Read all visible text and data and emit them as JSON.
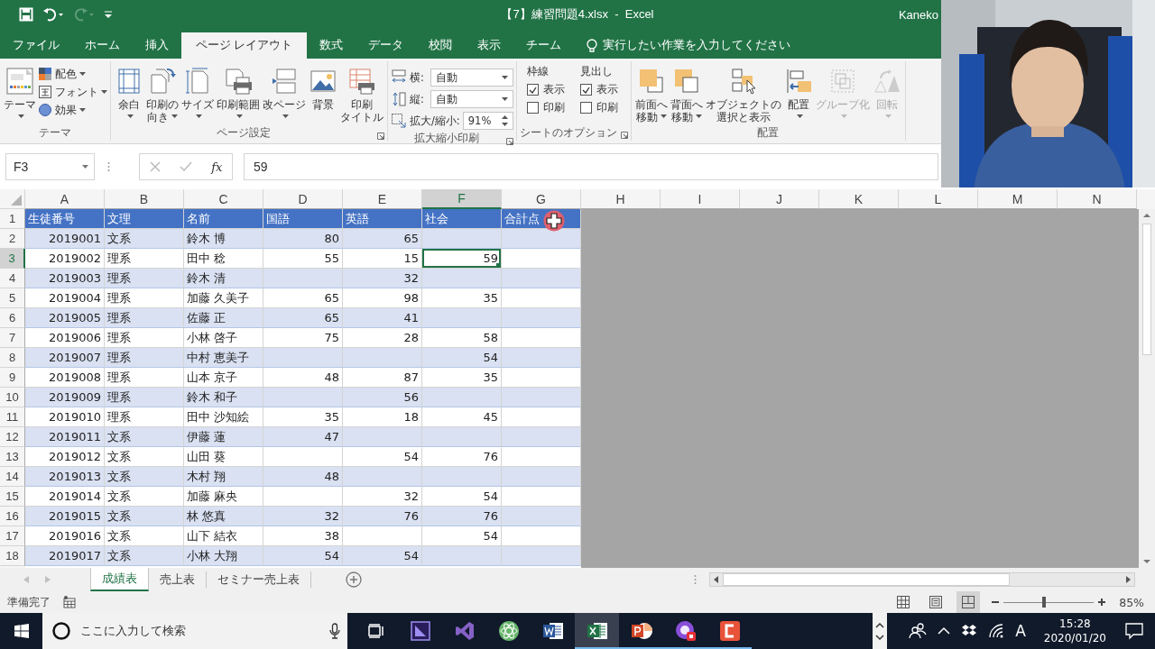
{
  "window": {
    "title": "【7】練習問題4.xlsx  -  Excel",
    "user": "Kaneko"
  },
  "ribbon_tabs": [
    {
      "label": "ファイル",
      "selected": false
    },
    {
      "label": "ホーム",
      "selected": false
    },
    {
      "label": "挿入",
      "selected": false
    },
    {
      "label": "ページ レイアウト",
      "selected": true
    },
    {
      "label": "数式",
      "selected": false
    },
    {
      "label": "データ",
      "selected": false
    },
    {
      "label": "校閲",
      "selected": false
    },
    {
      "label": "表示",
      "selected": false
    },
    {
      "label": "チーム",
      "selected": false
    }
  ],
  "tell_me": {
    "placeholder": "実行したい作業を入力してください"
  },
  "ribbon": {
    "groups": [
      {
        "kind": "theme",
        "label": "テーマ",
        "launcher": false,
        "large": [
          {
            "lines": [
              "テーマ"
            ],
            "dropdown": true,
            "disabled": false
          }
        ],
        "small": [
          {
            "label": "配色",
            "dropdown": true
          },
          {
            "label": "フォント",
            "dropdown": true
          },
          {
            "label": "効果",
            "dropdown": true
          }
        ]
      },
      {
        "kind": "buttons",
        "label": "ページ設定",
        "launcher": true,
        "large": [
          {
            "lines": [
              "余白"
            ],
            "dropdown": true,
            "disabled": false
          },
          {
            "lines": [
              "印刷の",
              "向き"
            ],
            "dropdown": true,
            "disabled": false
          },
          {
            "lines": [
              "サイズ"
            ],
            "dropdown": true,
            "disabled": false
          },
          {
            "lines": [
              "印刷範囲"
            ],
            "dropdown": true,
            "disabled": false
          },
          {
            "lines": [
              "改ページ"
            ],
            "dropdown": true,
            "disabled": false
          },
          {
            "lines": [
              "背景"
            ],
            "dropdown": false,
            "disabled": false
          },
          {
            "lines": [
              "印刷",
              "タイトル"
            ],
            "dropdown": false,
            "disabled": false
          }
        ]
      },
      {
        "kind": "scale",
        "label": "拡大縮小印刷",
        "launcher": true,
        "fields": [
          {
            "label": "横:",
            "value": "自動",
            "kind": "dropdown"
          },
          {
            "label": "縦:",
            "value": "自動",
            "kind": "dropdown"
          },
          {
            "label": "拡大/縮小:",
            "value": "91%",
            "kind": "spinner"
          }
        ]
      },
      {
        "kind": "options",
        "label": "シートのオプション",
        "launcher": true,
        "columns": [
          {
            "heading": "枠線",
            "checks": [
              {
                "label": "表示",
                "checked": true
              },
              {
                "label": "印刷",
                "checked": false
              }
            ]
          },
          {
            "heading": "見出し",
            "checks": [
              {
                "label": "表示",
                "checked": true
              },
              {
                "label": "印刷",
                "checked": false
              }
            ]
          }
        ]
      },
      {
        "kind": "buttons",
        "label": "配置",
        "launcher": false,
        "large": [
          {
            "lines": [
              "前面へ",
              "移動"
            ],
            "dropdown": true,
            "disabled": false
          },
          {
            "lines": [
              "背面へ",
              "移動"
            ],
            "dropdown": true,
            "disabled": false
          },
          {
            "lines": [
              "オブジェクトの",
              "選択と表示"
            ],
            "dropdown": false,
            "disabled": false
          },
          {
            "lines": [
              "配置"
            ],
            "dropdown": true,
            "disabled": false
          },
          {
            "lines": [
              "グループ化"
            ],
            "dropdown": true,
            "disabled": true
          },
          {
            "lines": [
              "回転"
            ],
            "dropdown": true,
            "disabled": true
          }
        ]
      }
    ]
  },
  "formula_bar": {
    "name_box": "F3",
    "insert_function": "fx",
    "value": "59"
  },
  "sheet": {
    "columns": [
      {
        "letter": "A",
        "kind": "number",
        "selected": false
      },
      {
        "letter": "B",
        "kind": "text",
        "selected": false
      },
      {
        "letter": "C",
        "kind": "text",
        "selected": false
      },
      {
        "letter": "D",
        "kind": "number",
        "selected": false
      },
      {
        "letter": "E",
        "kind": "number",
        "selected": false
      },
      {
        "letter": "F",
        "kind": "number",
        "selected": true
      },
      {
        "letter": "G",
        "kind": "number",
        "selected": false
      },
      {
        "letter": "H",
        "selected": false
      },
      {
        "letter": "I",
        "selected": false
      },
      {
        "letter": "J",
        "selected": false
      },
      {
        "letter": "K",
        "selected": false
      },
      {
        "letter": "L",
        "selected": false
      },
      {
        "letter": "M",
        "selected": false
      },
      {
        "letter": "N",
        "selected": false
      }
    ],
    "rows": [
      {
        "number": "1",
        "kind": "header",
        "selected": false,
        "cells": [
          "生徒番号",
          "文理",
          "名前",
          "国語",
          "英語",
          "社会",
          "合計点"
        ]
      },
      {
        "number": "2",
        "kind": "data",
        "selected": false,
        "cells": [
          "2019001",
          "文系",
          "鈴木 博",
          "80",
          "65",
          null,
          null
        ]
      },
      {
        "number": "3",
        "kind": "data",
        "selected": true,
        "cells": [
          "2019002",
          "理系",
          "田中 稔",
          "55",
          "15",
          "59",
          null
        ]
      },
      {
        "number": "4",
        "kind": "data",
        "selected": false,
        "cells": [
          "2019003",
          "理系",
          "鈴木 清",
          null,
          "32",
          null,
          null
        ]
      },
      {
        "number": "5",
        "kind": "data",
        "selected": false,
        "cells": [
          "2019004",
          "理系",
          "加藤 久美子",
          "65",
          "98",
          "35",
          null
        ]
      },
      {
        "number": "6",
        "kind": "data",
        "selected": false,
        "cells": [
          "2019005",
          "理系",
          "佐藤 正",
          "65",
          "41",
          null,
          null
        ]
      },
      {
        "number": "7",
        "kind": "data",
        "selected": false,
        "cells": [
          "2019006",
          "理系",
          "小林 啓子",
          "75",
          "28",
          "58",
          null
        ]
      },
      {
        "number": "8",
        "kind": "data",
        "selected": false,
        "cells": [
          "2019007",
          "理系",
          "中村 恵美子",
          null,
          null,
          "54",
          null
        ]
      },
      {
        "number": "9",
        "kind": "data",
        "selected": false,
        "cells": [
          "2019008",
          "理系",
          "山本 京子",
          "48",
          "87",
          "35",
          null
        ]
      },
      {
        "number": "10",
        "kind": "data",
        "selected": false,
        "cells": [
          "2019009",
          "理系",
          "鈴木 和子",
          null,
          "56",
          null,
          null
        ]
      },
      {
        "number": "11",
        "kind": "data",
        "selected": false,
        "cells": [
          "2019010",
          "理系",
          "田中 沙知絵",
          "35",
          "18",
          "45",
          null
        ]
      },
      {
        "number": "12",
        "kind": "data",
        "selected": false,
        "cells": [
          "2019011",
          "文系",
          "伊藤 蓮",
          "47",
          null,
          null,
          null
        ]
      },
      {
        "number": "13",
        "kind": "data",
        "selected": false,
        "cells": [
          "2019012",
          "文系",
          "山田 葵",
          null,
          "54",
          "76",
          null
        ]
      },
      {
        "number": "14",
        "kind": "data",
        "selected": false,
        "cells": [
          "2019013",
          "文系",
          "木村 翔",
          "48",
          null,
          null,
          null
        ]
      },
      {
        "number": "15",
        "kind": "data",
        "selected": false,
        "cells": [
          "2019014",
          "文系",
          "加藤 麻央",
          null,
          "32",
          "54",
          null
        ]
      },
      {
        "number": "16",
        "kind": "data",
        "selected": false,
        "cells": [
          "2019015",
          "文系",
          "林 悠真",
          "32",
          "76",
          "76",
          null
        ]
      },
      {
        "number": "17",
        "kind": "data",
        "selected": false,
        "cells": [
          "2019016",
          "文系",
          "山下 結衣",
          "38",
          null,
          "54",
          null
        ]
      },
      {
        "number": "18",
        "kind": "data",
        "selected": false,
        "cells": [
          "2019017",
          "文系",
          "小林 大翔",
          "54",
          "54",
          null,
          null
        ]
      }
    ]
  },
  "sheet_tabs": [
    {
      "label": "成績表",
      "selected": true
    },
    {
      "label": "売上表",
      "selected": false
    },
    {
      "label": "セミナー売上表",
      "selected": false
    }
  ],
  "status_bar": {
    "text": "準備完了",
    "views": [
      {
        "selected": false
      },
      {
        "selected": false
      },
      {
        "selected": true
      }
    ],
    "zoom": {
      "level": 0.45,
      "reading": "85%"
    }
  },
  "taskbar": {
    "search_placeholder": "ここに入力して検索",
    "apps": [
      {
        "running": false,
        "active": false
      },
      {
        "running": false,
        "active": false
      },
      {
        "running": false,
        "active": false
      },
      {
        "running": false,
        "active": false
      },
      {
        "running": true,
        "active": true
      },
      {
        "running": true,
        "active": false
      },
      {
        "running": true,
        "active": false
      },
      {
        "running": true,
        "active": false
      }
    ],
    "input_mode": "A",
    "time": "15:28",
    "date": "2020/01/20"
  }
}
